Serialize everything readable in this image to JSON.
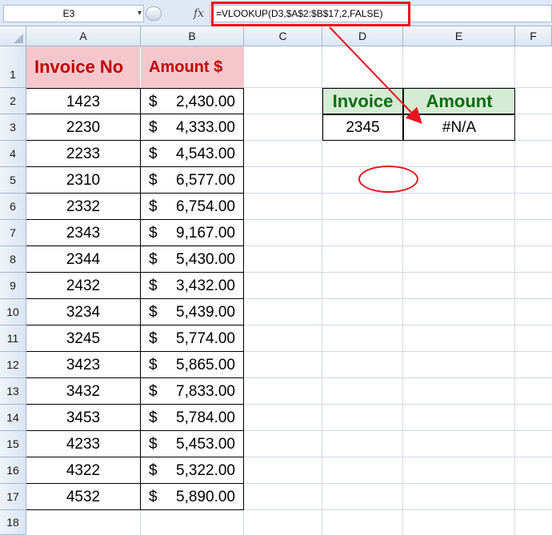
{
  "formula_bar": {
    "name_box": "E3",
    "name_box_dropdown": "▾",
    "fx_label": "fx",
    "formula": "=VLOOKUP(D3,$A$2:$B$17,2,FALSE)"
  },
  "columns": [
    "A",
    "B",
    "C",
    "D",
    "E",
    "F"
  ],
  "rows": [
    "1",
    "2",
    "3",
    "4",
    "5",
    "6",
    "7",
    "8",
    "9",
    "10",
    "11",
    "12",
    "13",
    "14",
    "15",
    "16",
    "17",
    "18"
  ],
  "table": {
    "header_invoice": "Invoice No",
    "header_amount": "Amount $",
    "currency": "$",
    "records": [
      {
        "invoice": "1423",
        "amount": "2,430.00"
      },
      {
        "invoice": "2230",
        "amount": "4,333.00"
      },
      {
        "invoice": "2233",
        "amount": "4,543.00"
      },
      {
        "invoice": "2310",
        "amount": "6,577.00"
      },
      {
        "invoice": "2332",
        "amount": "6,754.00"
      },
      {
        "invoice": "2343",
        "amount": "9,167.00"
      },
      {
        "invoice": "2344",
        "amount": "5,430.00"
      },
      {
        "invoice": "2432",
        "amount": "3,432.00"
      },
      {
        "invoice": "3234",
        "amount": "5,439.00"
      },
      {
        "invoice": "3245",
        "amount": "5,774.00"
      },
      {
        "invoice": "3423",
        "amount": "5,865.00"
      },
      {
        "invoice": "3432",
        "amount": "7,833.00"
      },
      {
        "invoice": "3453",
        "amount": "5,784.00"
      },
      {
        "invoice": "4233",
        "amount": "5,453.00"
      },
      {
        "invoice": "4322",
        "amount": "5,322.00"
      },
      {
        "invoice": "4532",
        "amount": "5,890.00"
      }
    ]
  },
  "lookup": {
    "header_invoice": "Invoice",
    "header_amount": "Amount",
    "invoice_value": "2345",
    "result": "#N/A"
  },
  "colors": {
    "highlight": "#e8141e",
    "header_fill": "#f5c7cd",
    "header_text": "#c00000",
    "lookup_fill": "#d4ecd4",
    "lookup_text": "#0b6b12"
  }
}
